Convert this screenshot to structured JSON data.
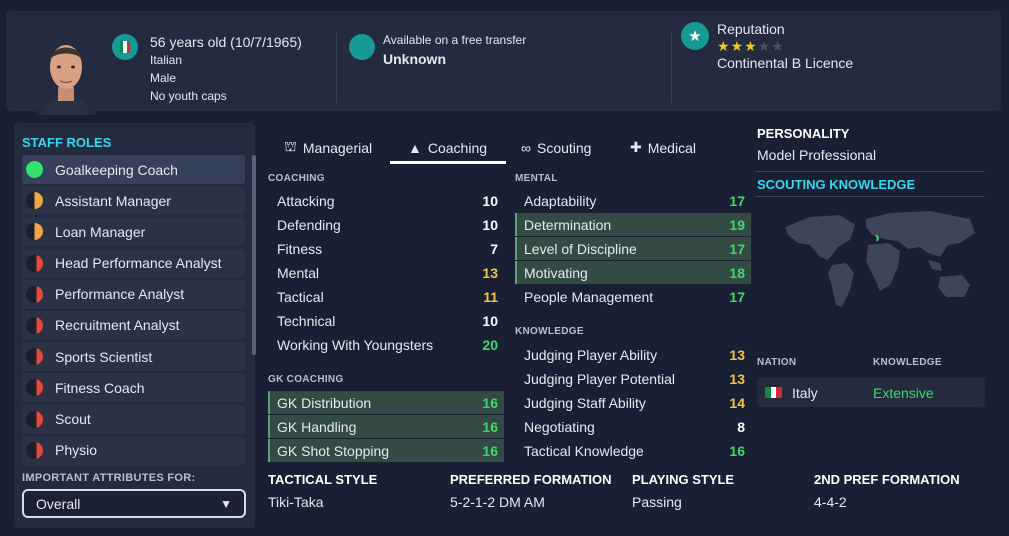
{
  "profile": {
    "age_line": "56 years old (10/7/1965)",
    "nationality": "Italian",
    "gender": "Male",
    "caps": "No youth caps"
  },
  "transfer": {
    "status": "Available on a free transfer",
    "value": "Unknown"
  },
  "reputation": {
    "label": "Reputation",
    "stars_filled": 3,
    "stars_total": 5,
    "licence": "Continental B Licence"
  },
  "staff_roles": {
    "title": "STAFF ROLES",
    "items": [
      {
        "label": "Goalkeeping Coach",
        "suitability": "full"
      },
      {
        "label": "Assistant Manager",
        "suitability": "half"
      },
      {
        "label": "Loan Manager",
        "suitability": "half"
      },
      {
        "label": "Head Performance Analyst",
        "suitability": "low"
      },
      {
        "label": "Performance Analyst",
        "suitability": "low"
      },
      {
        "label": "Recruitment Analyst",
        "suitability": "low"
      },
      {
        "label": "Sports Scientist",
        "suitability": "low"
      },
      {
        "label": "Fitness Coach",
        "suitability": "low"
      },
      {
        "label": "Scout",
        "suitability": "low"
      },
      {
        "label": "Physio",
        "suitability": "low"
      }
    ],
    "important_label": "IMPORTANT ATTRIBUTES FOR:",
    "important_value": "Overall"
  },
  "tabs": [
    {
      "label": "Managerial",
      "icon": "people-icon"
    },
    {
      "label": "Coaching",
      "icon": "cones-icon",
      "active": true
    },
    {
      "label": "Scouting",
      "icon": "binoculars-icon"
    },
    {
      "label": "Medical",
      "icon": "medical-kit-icon"
    }
  ],
  "coaching": {
    "title": "COACHING",
    "items": [
      {
        "label": "Attacking",
        "value": "10",
        "color": "white"
      },
      {
        "label": "Defending",
        "value": "10",
        "color": "white"
      },
      {
        "label": "Fitness",
        "value": "7",
        "color": "white"
      },
      {
        "label": "Mental",
        "value": "13",
        "color": "yellow"
      },
      {
        "label": "Tactical",
        "value": "11",
        "color": "yellow"
      },
      {
        "label": "Technical",
        "value": "10",
        "color": "white"
      },
      {
        "label": "Working With Youngsters",
        "value": "20",
        "color": "green"
      }
    ]
  },
  "gk_coaching": {
    "title": "GK COACHING",
    "items": [
      {
        "label": "GK Distribution",
        "value": "16",
        "color": "green",
        "highlight": true
      },
      {
        "label": "GK Handling",
        "value": "16",
        "color": "green",
        "highlight": true
      },
      {
        "label": "GK Shot Stopping",
        "value": "16",
        "color": "green",
        "highlight": true
      }
    ]
  },
  "mental": {
    "title": "MENTAL",
    "items": [
      {
        "label": "Adaptability",
        "value": "17",
        "color": "green"
      },
      {
        "label": "Determination",
        "value": "19",
        "color": "green",
        "highlight": true
      },
      {
        "label": "Level of Discipline",
        "value": "17",
        "color": "green",
        "highlight": true
      },
      {
        "label": "Motivating",
        "value": "18",
        "color": "green",
        "highlight": true
      },
      {
        "label": "People Management",
        "value": "17",
        "color": "green"
      }
    ]
  },
  "knowledge": {
    "title": "KNOWLEDGE",
    "items": [
      {
        "label": "Judging Player Ability",
        "value": "13",
        "color": "yellow"
      },
      {
        "label": "Judging Player Potential",
        "value": "13",
        "color": "yellow"
      },
      {
        "label": "Judging Staff Ability",
        "value": "14",
        "color": "yellow"
      },
      {
        "label": "Negotiating",
        "value": "8",
        "color": "white"
      },
      {
        "label": "Tactical Knowledge",
        "value": "16",
        "color": "green"
      }
    ]
  },
  "personality": {
    "title": "PERSONALITY",
    "value": "Model Professional"
  },
  "scouting_knowledge": {
    "title": "SCOUTING KNOWLEDGE",
    "col_nation": "NATION",
    "col_knowledge": "KNOWLEDGE",
    "rows": [
      {
        "nation": "Italy",
        "knowledge": "Extensive"
      }
    ]
  },
  "bottom": {
    "tactical_style_label": "TACTICAL STYLE",
    "tactical_style": "Tiki-Taka",
    "pref_formation_label": "PREFERRED FORMATION",
    "pref_formation": "5-2-1-2 DM AM",
    "playing_style_label": "PLAYING STYLE",
    "playing_style": "Passing",
    "second_formation_label": "2ND PREF FORMATION",
    "second_formation": "4-4-2"
  },
  "colors": {
    "background": "#1a2033",
    "panel": "#242b3e",
    "accent_cyan": "#37d7f0",
    "teal": "#179a96",
    "green": "#3fd96b",
    "yellow": "#f2c53d",
    "italy_flag": [
      "#009246",
      "#ffffff",
      "#ce2b37"
    ]
  }
}
